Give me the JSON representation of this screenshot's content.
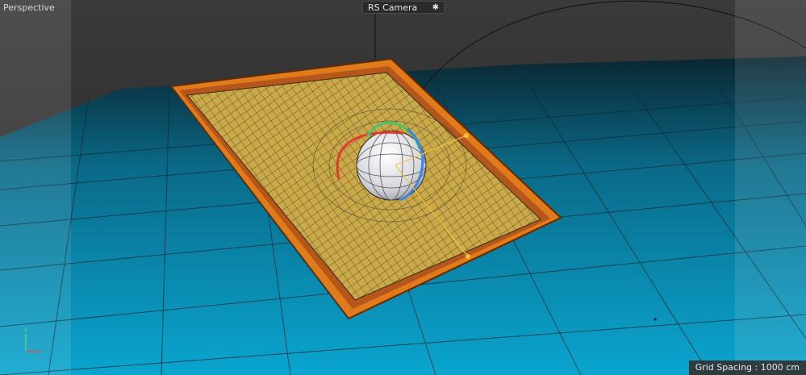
{
  "viewport": {
    "label": "Perspective",
    "camera_label": "RS Camera",
    "camera_icon": "camera-icon",
    "grid_spacing_text": "Grid Spacing : 1000 cm"
  },
  "axis": {
    "x": "x",
    "y": "y",
    "z": "z"
  },
  "colors": {
    "background": "#2e2e2e",
    "floor": "#0a7ea0",
    "plane_fill": "#c9a94a",
    "frame": "#e07a1a",
    "sphere": "#e9e9ee"
  }
}
